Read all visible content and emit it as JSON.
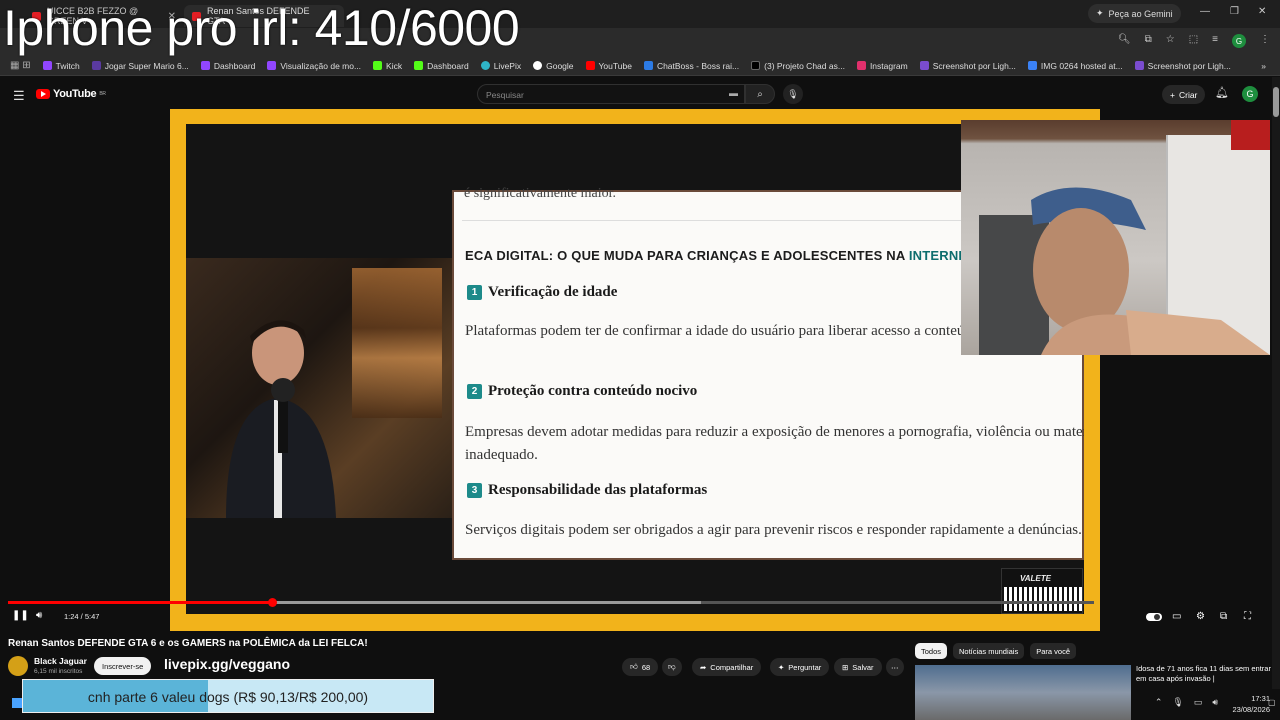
{
  "overlay_title": "Iphone pro irl: 410/6000",
  "browser": {
    "tabs": [
      {
        "label": "UICCE B2B FEZZO @ GREEN V"
      },
      {
        "label": "Renan Santos DEFENDE GTA"
      }
    ],
    "gemini_label": "Peça ao Gemini",
    "profile_initial": "G",
    "bookmarks": [
      {
        "label": "Twitch",
        "color": "#9146ff"
      },
      {
        "label": "Jogar Super Mario 6...",
        "color": "#5a3aa0"
      },
      {
        "label": "Dashboard",
        "color": "#9146ff"
      },
      {
        "label": "Visualização de mo...",
        "color": "#9146ff"
      },
      {
        "label": "Kick",
        "color": "#53fc18"
      },
      {
        "label": "Dashboard",
        "color": "#53fc18"
      },
      {
        "label": "LivePix",
        "color": "#2fb5c8"
      },
      {
        "label": "Google",
        "color": "#ffffff"
      },
      {
        "label": "YouTube",
        "color": "#ff0000"
      },
      {
        "label": "ChatBoss - Boss rai...",
        "color": "#2c7be5"
      },
      {
        "label": "(3) Projeto Chad as...",
        "color": "#000000"
      },
      {
        "label": "Instagram",
        "color": "#e1306c"
      },
      {
        "label": "Screenshot por Ligh...",
        "color": "#7a4ccf"
      },
      {
        "label": "IMG 0264 hosted at...",
        "color": "#3b82f6"
      },
      {
        "label": "Screenshot por Ligh...",
        "color": "#7a4ccf"
      }
    ]
  },
  "youtube": {
    "logo_text": "YouTube",
    "logo_region": "BR",
    "search_placeholder": "Pesquisar",
    "create_label": "Criar",
    "avatar_initial": "G"
  },
  "slide": {
    "top_text": "é significativamente maior.",
    "heading": "ECA DIGITAL: O QUE MUDA PARA CRIANÇAS E ADOLESCENTES NA ",
    "heading_highlight": "INTERNET",
    "sections": [
      {
        "num": "1",
        "title": "Verificação de idade",
        "body": "Plataformas podem ter de confirmar a idade do usuário para liberar acesso a conteúdos ou serviços."
      },
      {
        "num": "2",
        "title": "Proteção contra conteúdo nocivo",
        "body": "Empresas devem adotar medidas para reduzir a exposição de menores a pornografia, violência ou material inadequado."
      },
      {
        "num": "3",
        "title": "Responsabilidade das plataformas",
        "body": "Serviços digitais podem ser obrigados a agir para prevenir riscos e responder rapidamente a denúncias."
      }
    ],
    "badge": "VALETE"
  },
  "player": {
    "time": "1:24 / 5:47",
    "progress_played": 0.243,
    "progress_buffered": 0.638
  },
  "video": {
    "title": "Renan Santos DEFENDE GTA 6 e os GAMERS na POLÊMICA da LEI FELCA!",
    "channel": "Black Jaguar",
    "subscribers": "6,15 mil inscritos",
    "subscribe_label": "Inscrever-se",
    "likes": "68",
    "share_label": "Compartilhar",
    "ask_label": "Perguntar",
    "save_label": "Salvar"
  },
  "stream_overlay": {
    "livepix_url": "livepix.gg/veggano",
    "donation_text": "cnh parte 6 valeu dogs (R$ 90,13/R$ 200,00)",
    "donation_progress": 0.45
  },
  "sidebar": {
    "chips": [
      "Todos",
      "Notícias mundiais",
      "Para você"
    ],
    "rec_title": "Idosa de 71 anos fica 11 dias sem entrar em casa após invasão |"
  },
  "taskbar": {
    "time": "17:31",
    "date": "23/08/2026"
  }
}
